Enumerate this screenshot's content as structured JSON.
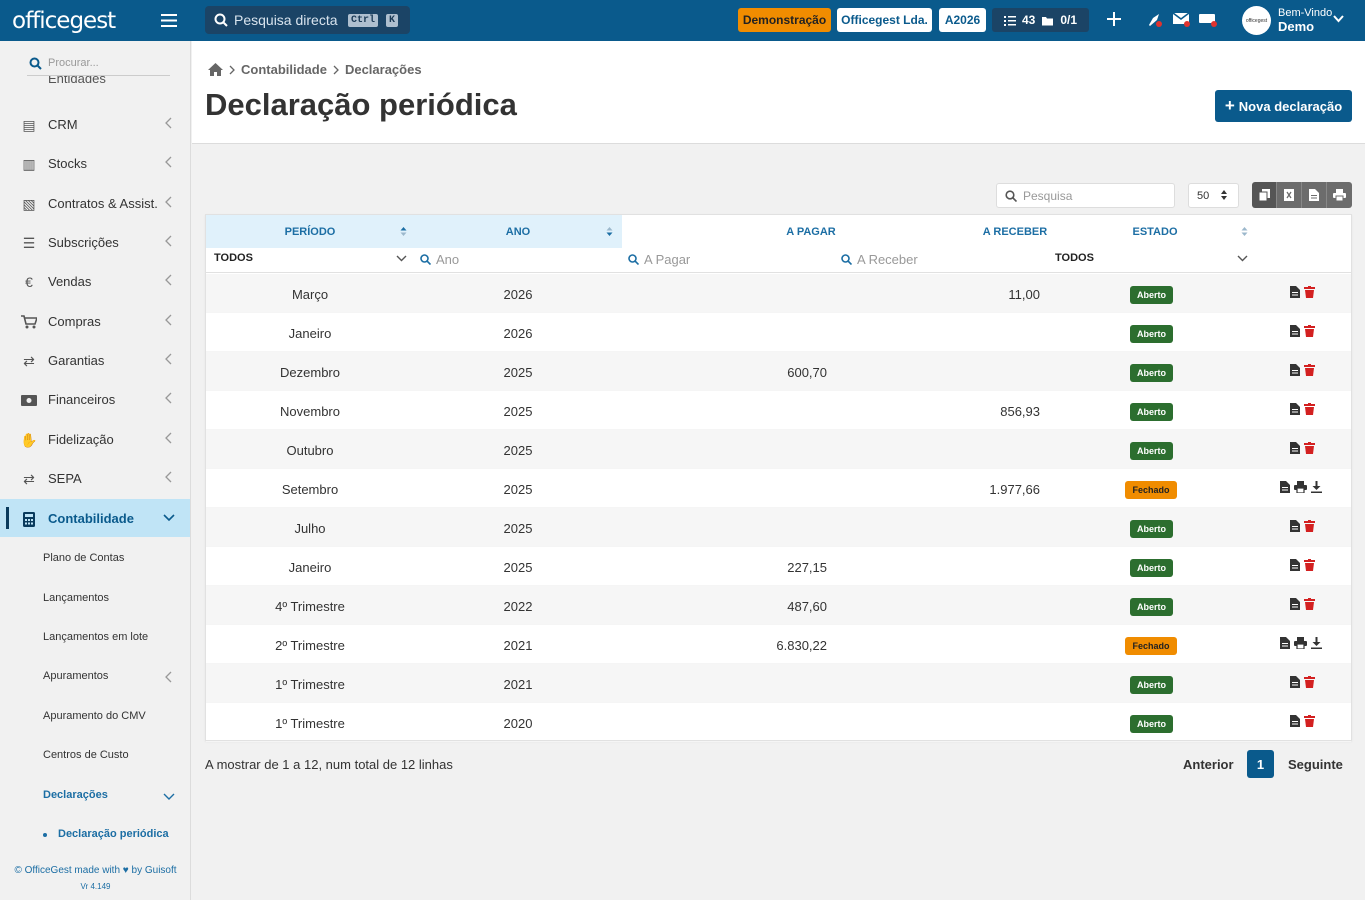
{
  "topbar": {
    "logo": "officegest",
    "search_placeholder": "Pesquisa directa",
    "kbd1": "Ctrl",
    "kbd2": "K",
    "demo": "Demonstração",
    "company": "Officegest Lda.",
    "year": "A2026",
    "tasks_count": "43",
    "files_count": "0/1",
    "avatar_text": "officegest",
    "welcome": "Bem-Vindo",
    "user": "Demo"
  },
  "sidebar": {
    "search_placeholder": "Procurar...",
    "partial_item": "Entidades",
    "items": [
      {
        "label": "CRM",
        "icon": "people-icon"
      },
      {
        "label": "Stocks",
        "icon": "warehouse-icon"
      },
      {
        "label": "Contratos & Assist.",
        "icon": "contract-icon"
      },
      {
        "label": "Subscrições",
        "icon": "list-icon"
      },
      {
        "label": "Vendas",
        "icon": "euro-icon"
      },
      {
        "label": "Compras",
        "icon": "cart-icon"
      },
      {
        "label": "Garantias",
        "icon": "exchange-icon"
      },
      {
        "label": "Financeiros",
        "icon": "money-icon"
      },
      {
        "label": "Fidelização",
        "icon": "hand-icon"
      },
      {
        "label": "SEPA",
        "icon": "exchange-icon"
      },
      {
        "label": "Contabilidade",
        "icon": "calculator-icon"
      }
    ],
    "subitems": [
      "Plano de Contas",
      "Lançamentos",
      "Lançamentos em lote",
      "Apuramentos",
      "Apuramento do CMV",
      "Centros de Custo",
      "Declarações"
    ],
    "leaf": "Declaração periódica",
    "footer_pre": "© OfficeGest made with",
    "footer_post": "by Guisoft",
    "version": "Vr 4.149"
  },
  "breadcrumb": {
    "level1": "Contabilidade",
    "level2": "Declarações"
  },
  "page_title": "Declaração periódica",
  "new_button": "Nova declaração",
  "table_search_placeholder": "Pesquisa",
  "page_size": "50",
  "table": {
    "headers": {
      "periodo": "PERÍODO",
      "ano": "ANO",
      "pagar": "A PAGAR",
      "receber": "A RECEBER",
      "estado": "ESTADO"
    },
    "filters": {
      "periodo": "TODOS",
      "ano": "Ano",
      "pagar": "A Pagar",
      "receber": "A Receber",
      "estado": "TODOS"
    },
    "rows": [
      {
        "periodo": "Março",
        "ano": "2026",
        "pagar": "",
        "receber": "11,00",
        "estado": "Aberto"
      },
      {
        "periodo": "Janeiro",
        "ano": "2026",
        "pagar": "",
        "receber": "",
        "estado": "Aberto"
      },
      {
        "periodo": "Dezembro",
        "ano": "2025",
        "pagar": "600,70",
        "receber": "",
        "estado": "Aberto"
      },
      {
        "periodo": "Novembro",
        "ano": "2025",
        "pagar": "",
        "receber": "856,93",
        "estado": "Aberto"
      },
      {
        "periodo": "Outubro",
        "ano": "2025",
        "pagar": "",
        "receber": "",
        "estado": "Aberto"
      },
      {
        "periodo": "Setembro",
        "ano": "2025",
        "pagar": "",
        "receber": "1.977,66",
        "estado": "Fechado"
      },
      {
        "periodo": "Julho",
        "ano": "2025",
        "pagar": "",
        "receber": "",
        "estado": "Aberto"
      },
      {
        "periodo": "Janeiro",
        "ano": "2025",
        "pagar": "227,15",
        "receber": "",
        "estado": "Aberto"
      },
      {
        "periodo": "4º Trimestre",
        "ano": "2022",
        "pagar": "487,60",
        "receber": "",
        "estado": "Aberto"
      },
      {
        "periodo": "2º Trimestre",
        "ano": "2021",
        "pagar": "6.830,22",
        "receber": "",
        "estado": "Fechado"
      },
      {
        "periodo": "1º Trimestre",
        "ano": "2021",
        "pagar": "",
        "receber": "",
        "estado": "Aberto"
      },
      {
        "periodo": "1º Trimestre",
        "ano": "2020",
        "pagar": "",
        "receber": "",
        "estado": "Aberto"
      }
    ]
  },
  "pagination": {
    "info": "A mostrar de 1 a 12, num total de 12 linhas",
    "prev": "Anterior",
    "page": "1",
    "next": "Seguinte"
  },
  "colors": {
    "primary": "#0a5a8c",
    "open": "#2c6e2f",
    "closed": "#f08c00",
    "delete": "#d32020",
    "active_bg": "#c0e4f6"
  }
}
